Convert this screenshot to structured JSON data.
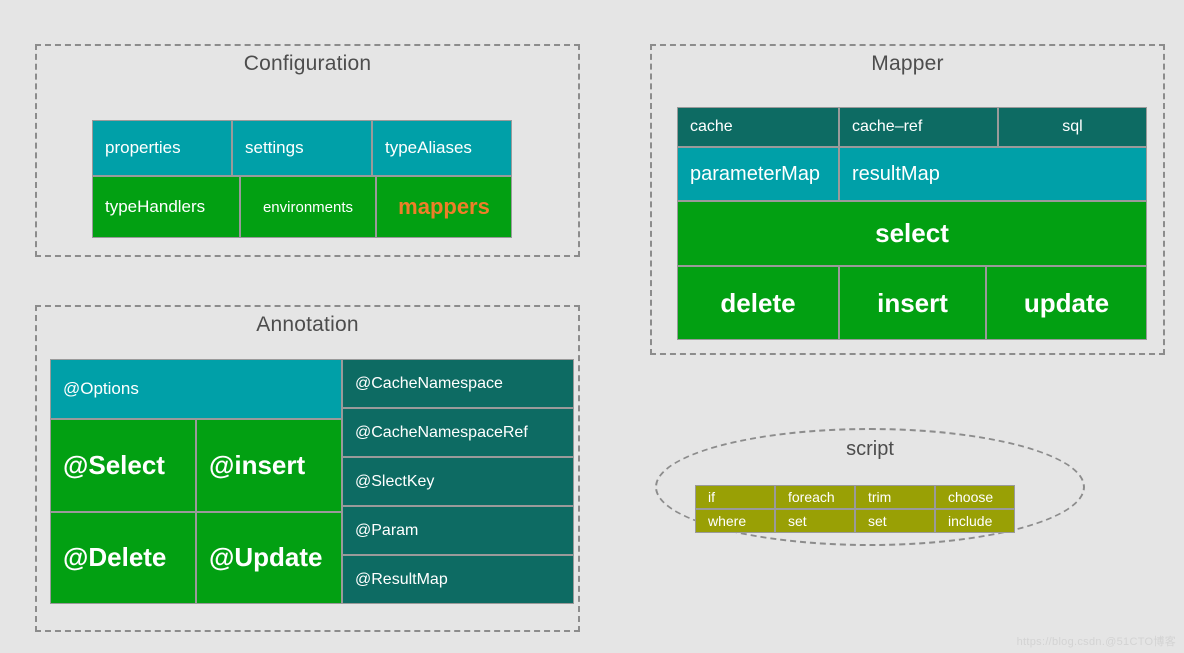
{
  "palette": {
    "background": "#e5e5e5",
    "teal": "#00a0a8",
    "dark_teal": "#0d6b63",
    "green": "#02a012",
    "olive": "#99a005",
    "orange_accent": "#ee7f28",
    "border_gray": "#8c8c8c",
    "title_text": "#4d4d4d"
  },
  "groups": {
    "configuration": {
      "title": "Configuration",
      "rows": [
        [
          {
            "label": "properties",
            "fill": "teal",
            "size": "md",
            "align": "left"
          },
          {
            "label": "settings",
            "fill": "teal",
            "size": "md",
            "align": "left"
          },
          {
            "label": "typeAliases",
            "fill": "teal",
            "size": "md",
            "align": "left"
          }
        ],
        [
          {
            "label": "typeHandlers",
            "fill": "green",
            "size": "md",
            "align": "left"
          },
          {
            "label": "environments",
            "fill": "green",
            "size": "sm",
            "align": "center"
          },
          {
            "label": "mappers",
            "fill": "green",
            "size": "accent",
            "align": "center"
          }
        ]
      ]
    },
    "mapper": {
      "title": "Mapper",
      "rows": [
        [
          {
            "label": "cache",
            "fill": "dark_teal",
            "size": "sm",
            "align": "left"
          },
          {
            "label": "cache–ref",
            "fill": "dark_teal",
            "size": "sm",
            "align": "left"
          },
          {
            "label": "sql",
            "fill": "dark_teal",
            "size": "sm",
            "align": "center"
          }
        ],
        [
          {
            "label": "parameterMap",
            "fill": "teal",
            "size": "md",
            "align": "left"
          },
          {
            "label": "resultMap",
            "fill": "teal",
            "size": "md",
            "align": "left"
          }
        ],
        [
          {
            "label": "select",
            "fill": "green",
            "size": "lg",
            "align": "center"
          }
        ],
        [
          {
            "label": "delete",
            "fill": "green",
            "size": "lg",
            "align": "center"
          },
          {
            "label": "insert",
            "fill": "green",
            "size": "lg",
            "align": "center"
          },
          {
            "label": "update",
            "fill": "green",
            "size": "lg",
            "align": "center"
          }
        ]
      ]
    },
    "annotation": {
      "title": "Annotation",
      "left_rows": [
        [
          {
            "label": "@Options",
            "fill": "teal",
            "size": "sm",
            "align": "left"
          }
        ],
        [
          {
            "label": "@Select",
            "fill": "green",
            "size": "big",
            "align": "left"
          },
          {
            "label": "@insert",
            "fill": "green",
            "size": "big",
            "align": "left"
          }
        ],
        [
          {
            "label": "@Delete",
            "fill": "green",
            "size": "big",
            "align": "left"
          },
          {
            "label": "@Update",
            "fill": "green",
            "size": "big",
            "align": "left"
          }
        ]
      ],
      "right_cells": [
        {
          "label": "@CacheNamespace",
          "fill": "dark_teal",
          "align": "left"
        },
        {
          "label": "@CacheNamespaceRef",
          "fill": "dark_teal",
          "align": "left"
        },
        {
          "label": "@SlectKey",
          "fill": "dark_teal",
          "align": "left"
        },
        {
          "label": "@Param",
          "fill": "dark_teal",
          "align": "left"
        },
        {
          "label": "@ResultMap",
          "fill": "dark_teal",
          "align": "left"
        }
      ]
    },
    "script": {
      "title": "script",
      "rows": [
        [
          {
            "label": "if",
            "fill": "olive",
            "align": "left"
          },
          {
            "label": "foreach",
            "fill": "olive",
            "align": "left"
          },
          {
            "label": "trim",
            "fill": "olive",
            "align": "left"
          },
          {
            "label": "choose",
            "fill": "olive",
            "align": "left"
          }
        ],
        [
          {
            "label": "where",
            "fill": "olive",
            "align": "left"
          },
          {
            "label": "set",
            "fill": "olive",
            "align": "left"
          },
          {
            "label": "set",
            "fill": "olive",
            "align": "left"
          },
          {
            "label": "include",
            "fill": "olive",
            "align": "left"
          }
        ]
      ]
    }
  },
  "watermark": "https://blog.csdn.@51CTO博客"
}
